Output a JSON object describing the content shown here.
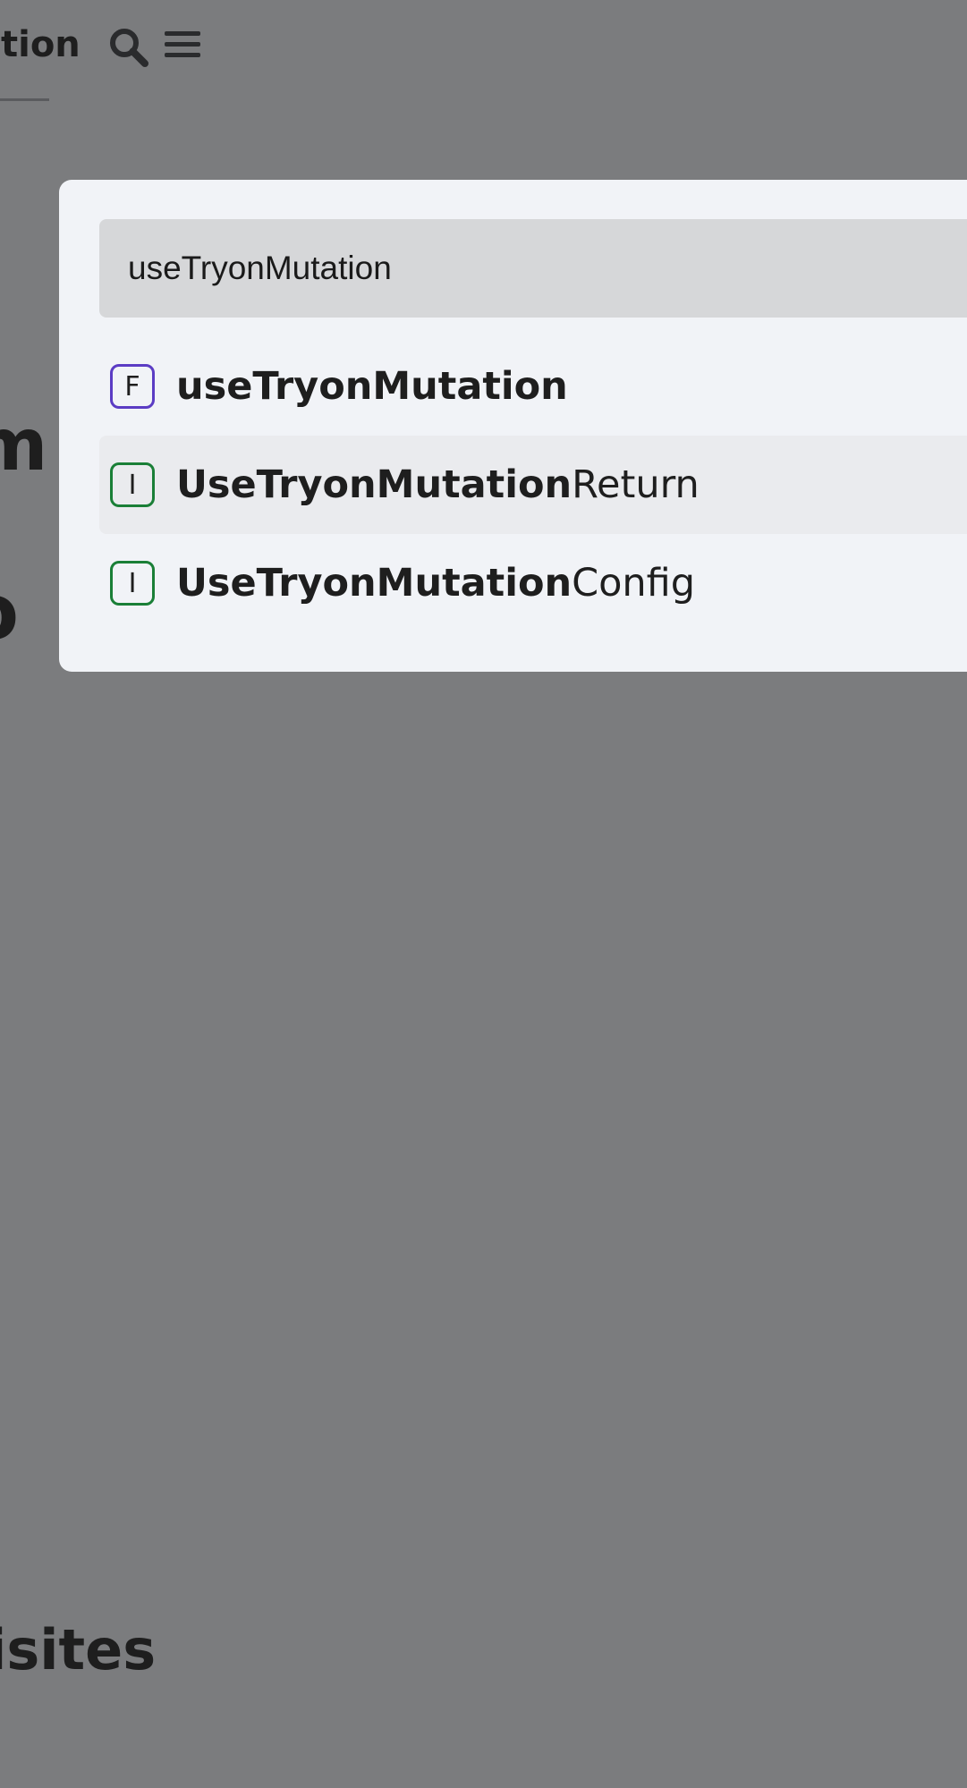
{
  "background": {
    "header_title": "ation",
    "headings": [
      "m",
      "o",
      "uisites"
    ]
  },
  "search": {
    "query": "useTryonMutation"
  },
  "results": [
    {
      "kind": "F",
      "kind_name": "function",
      "match": "useTryonMutation",
      "rest": ""
    },
    {
      "kind": "I",
      "kind_name": "interface",
      "match": "UseTryonMutation",
      "rest": "Return"
    },
    {
      "kind": "I",
      "kind_name": "interface",
      "match": "UseTryonMutation",
      "rest": "Config"
    }
  ],
  "colors": {
    "overlay": "#7b7c7e",
    "modal": "#f1f3f7",
    "input": "#d6d7d9",
    "function_badge": "#5b3cc4",
    "interface_badge": "#1a7f37"
  },
  "icons": {
    "search": "search-icon",
    "menu": "menu-icon"
  }
}
